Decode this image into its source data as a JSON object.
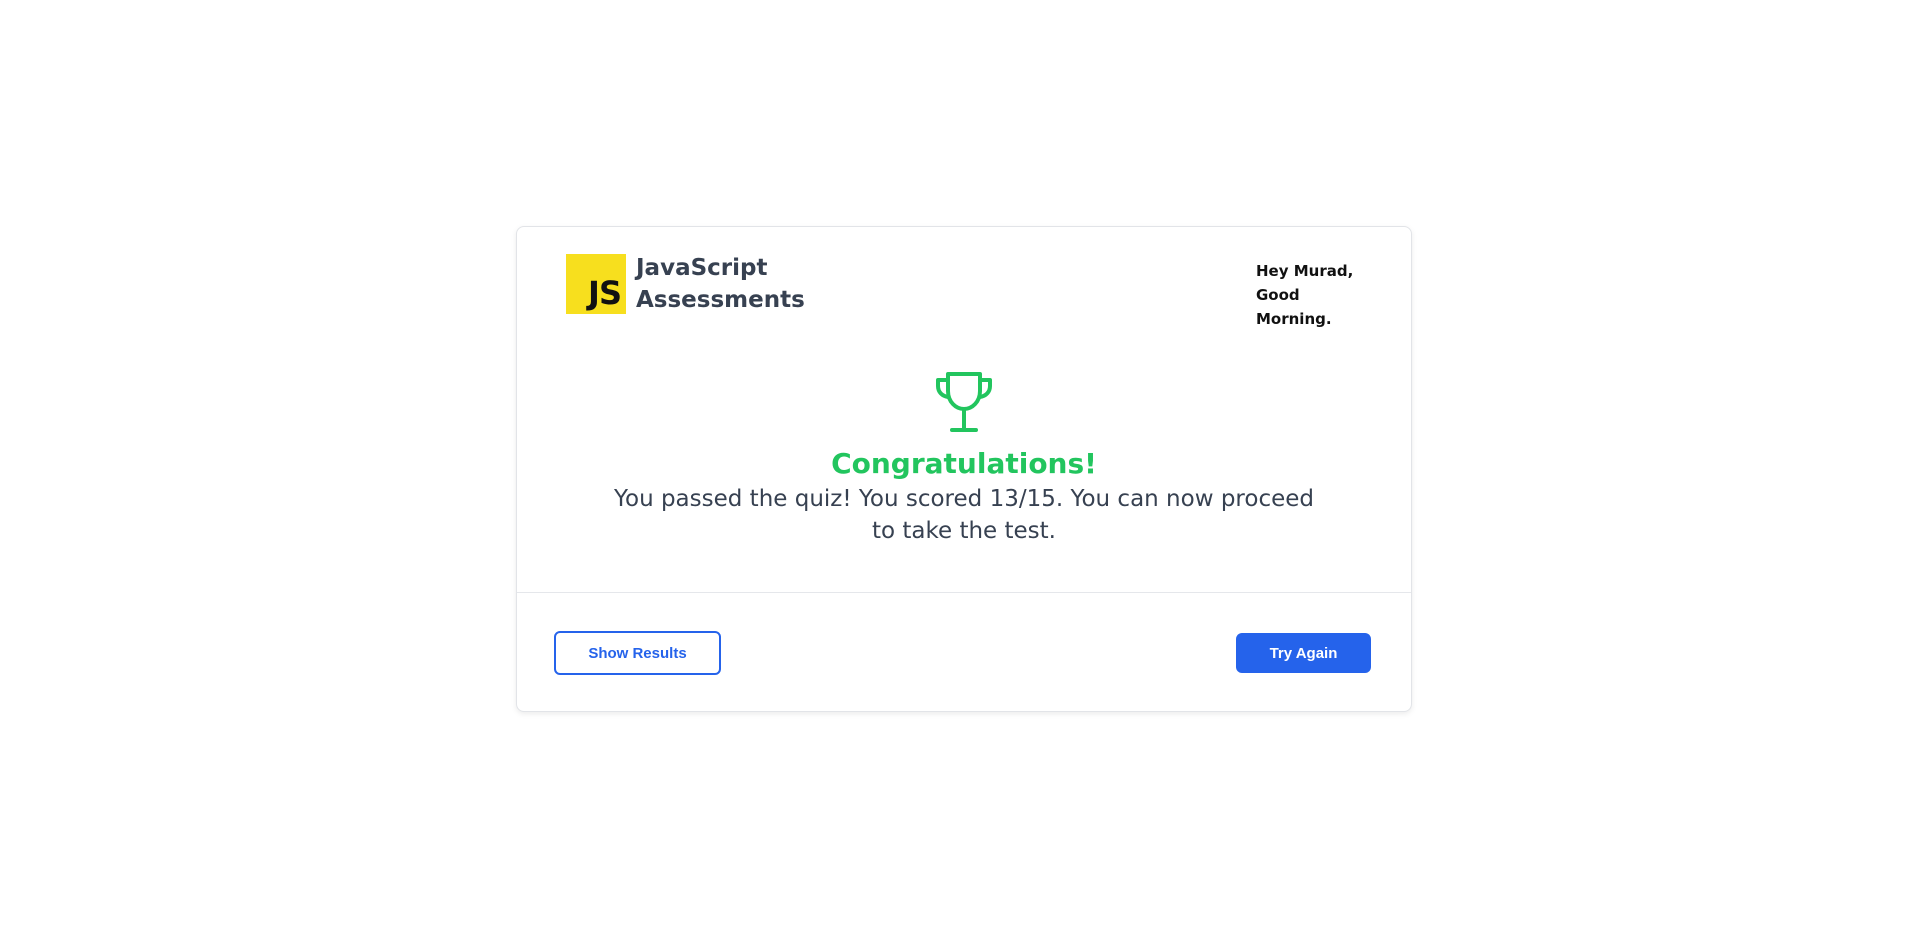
{
  "app": {
    "logo_text": "JS",
    "title": "JavaScript Assessments"
  },
  "greeting": {
    "line1": "Hey Murad,",
    "line2": "Good Morning."
  },
  "result": {
    "icon": "trophy-icon",
    "heading": "Congratulations!",
    "message": "You passed the quiz! You scored 13/15. You can now proceed to take the test."
  },
  "actions": {
    "show_results_label": "Show Results",
    "try_again_label": "Try Again"
  },
  "colors": {
    "logo_bg": "#f7df1e",
    "success": "#22c55e",
    "primary": "#2563eb",
    "text": "#374151"
  }
}
